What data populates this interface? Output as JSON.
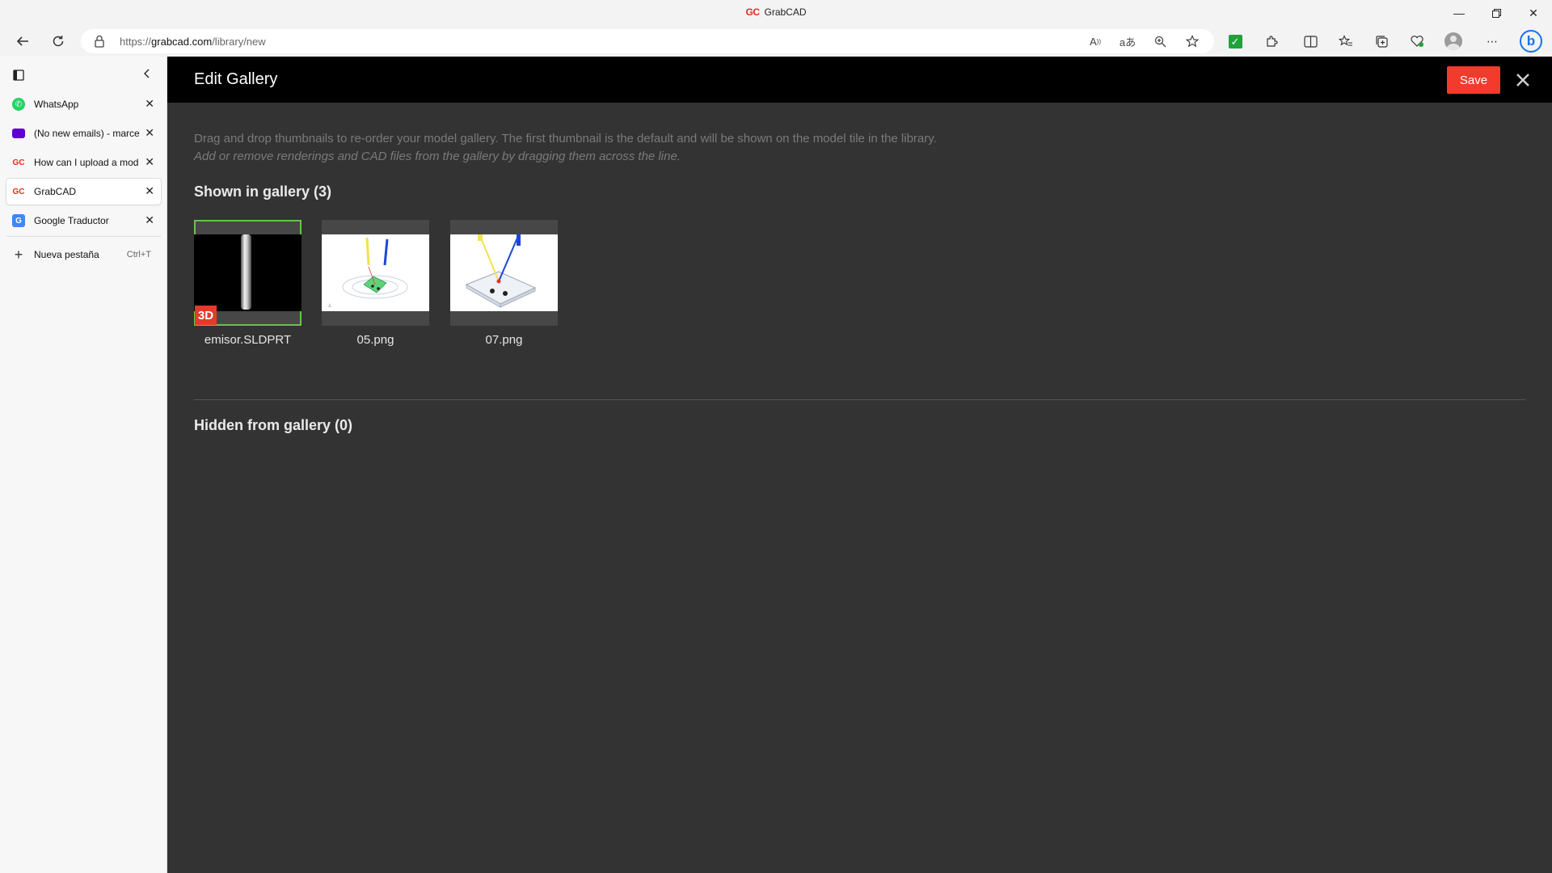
{
  "window": {
    "title": "GrabCAD",
    "favicon_text": "GC",
    "minimize_icon": "minimize-icon",
    "restore_icon": "restore-icon",
    "close_icon": "close-icon"
  },
  "toolbar": {
    "url_prefix": "https://",
    "url_domain": "grabcad.com",
    "url_path": "/library/new"
  },
  "sidebar": {
    "tabs": [
      {
        "label": "WhatsApp",
        "favicon": "whatsapp-icon",
        "color": "#25d366",
        "glyph": "●"
      },
      {
        "label": "(No new emails) - marce",
        "favicon": "mail-icon",
        "color": "#6001d2",
        "glyph": "✉"
      },
      {
        "label": "How can I upload a mod",
        "favicon": "grabcad-icon",
        "color": "#d6311f",
        "glyph": "GC"
      },
      {
        "label": "GrabCAD",
        "favicon": "grabcad-icon",
        "color": "#d6311f",
        "glyph": "GC",
        "active": true
      },
      {
        "label": "Google Traductor",
        "favicon": "google-translate-icon",
        "color": "#4285f4",
        "glyph": "G"
      }
    ],
    "new_tab_label": "Nueva pestaña",
    "new_tab_shortcut": "Ctrl+T"
  },
  "gallery": {
    "title": "Edit Gallery",
    "save_label": "Save",
    "instruction_1": "Drag and drop thumbnails to re-order your model gallery. The first thumbnail is the default and will be shown on the model tile in the library.",
    "instruction_2": "Add or remove renderings and CAD files from the gallery by dragging them across the line.",
    "shown_title": "Shown in gallery (3)",
    "hidden_title": "Hidden from gallery (0)",
    "items": [
      {
        "name": "emisor.SLDPRT",
        "badge": "3D"
      },
      {
        "name": "05.png"
      },
      {
        "name": "07.png"
      }
    ]
  },
  "colors": {
    "accent": "#f23b2c",
    "selected_outline": "#6cc24a",
    "content_bg": "#333333",
    "header_bg": "#000000"
  }
}
